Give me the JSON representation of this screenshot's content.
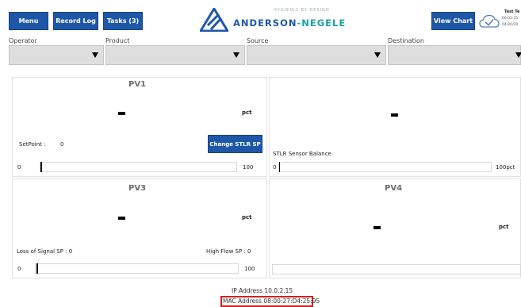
{
  "header": {
    "menu_label": "Menu",
    "record_log_label": "Record Log",
    "tasks_label": "Tasks (3)",
    "view_chart_label": "View Chart",
    "brand_tag": "HYGIENIC BY DESIGN",
    "brand_name_part1": "ANDERSON",
    "brand_name_sep": "-",
    "brand_name_part2": "NEGELE",
    "user_name": "Test Te",
    "user_time": "06:02:35",
    "user_date": "04/20/20",
    "brand_color": "#1f57a8",
    "accent_color": "#1aa0a6"
  },
  "selectors": {
    "operator_label": "Operator",
    "product_label": "Product",
    "source_label": "Source",
    "destination_label": "Destination"
  },
  "pv1": {
    "title": "PV1",
    "unit": "pct",
    "setpoint_label": "SetPoint :",
    "setpoint_value": "0",
    "change_button": "Change STLR SP",
    "bar_min": "0",
    "bar_max": "100",
    "bar_level": 0.1
  },
  "pv2": {
    "sensor_label": "STLR Sensor Balance",
    "bar_min": "0",
    "bar_max": "100pct",
    "bar_level": 0
  },
  "pv3": {
    "title": "PV3",
    "unit": "pct",
    "los_label": "Loss of Signal SP : 0",
    "high_flow_label": "High Flow SP : 0",
    "bar_min": "0",
    "bar_max": "100",
    "bar_level": 0.1
  },
  "pv4": {
    "title": "PV4",
    "unit": "pct"
  },
  "footer": {
    "ip_address": "IP Address 10.0.2.15",
    "mac_address": "MAC Address 08:00:27:D4:25:95",
    "highlight_color": "#d11f1f"
  }
}
